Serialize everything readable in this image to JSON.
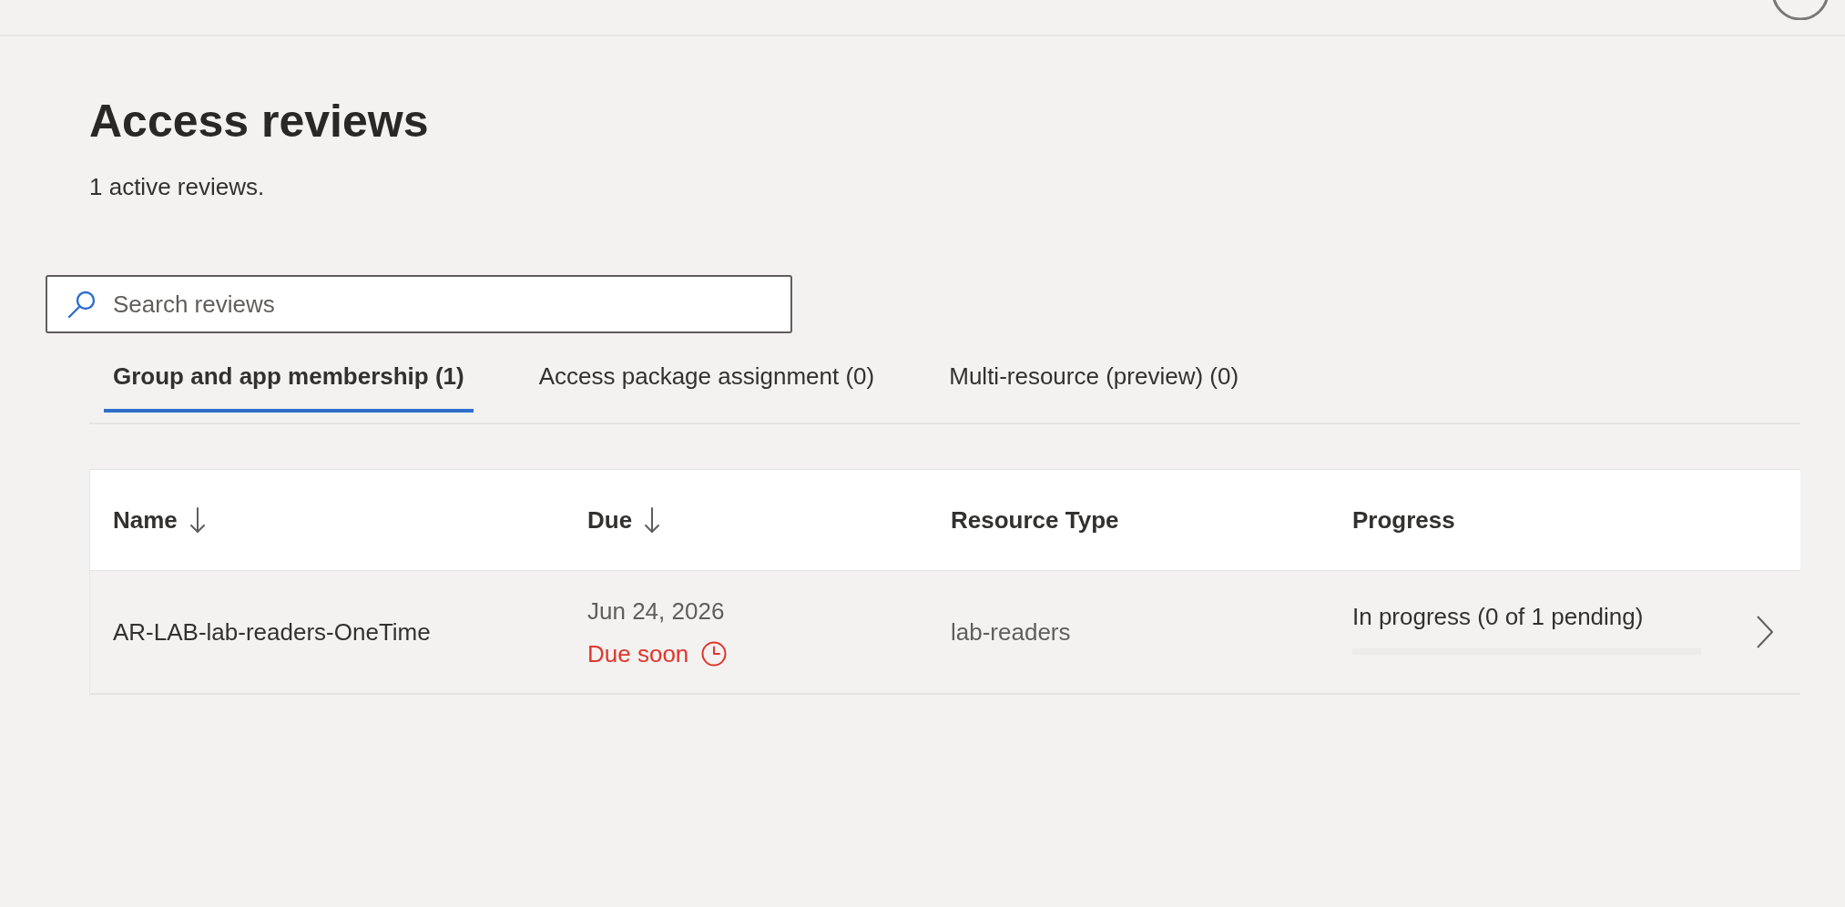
{
  "page": {
    "title": "Access reviews",
    "subtitle": "1 active reviews."
  },
  "search": {
    "placeholder": "Search reviews"
  },
  "tabs": [
    {
      "label": "Group and app membership (1)",
      "selected": true
    },
    {
      "label": "Access package assignment (0)",
      "selected": false
    },
    {
      "label": "Multi-resource (preview) (0)",
      "selected": false
    }
  ],
  "table": {
    "columns": [
      {
        "label": "Name",
        "sorted": true
      },
      {
        "label": "Due",
        "sorted": true
      },
      {
        "label": "Resource Type",
        "sorted": false
      },
      {
        "label": "Progress",
        "sorted": false
      }
    ],
    "rows": [
      {
        "name": "AR-LAB-lab-readers-OneTime",
        "due": "Jun 24, 2026",
        "due_note": "Due soon",
        "resource_type": "lab-readers",
        "progress": "In progress (0 of 1 pending)",
        "level": 0
      }
    ]
  }
}
